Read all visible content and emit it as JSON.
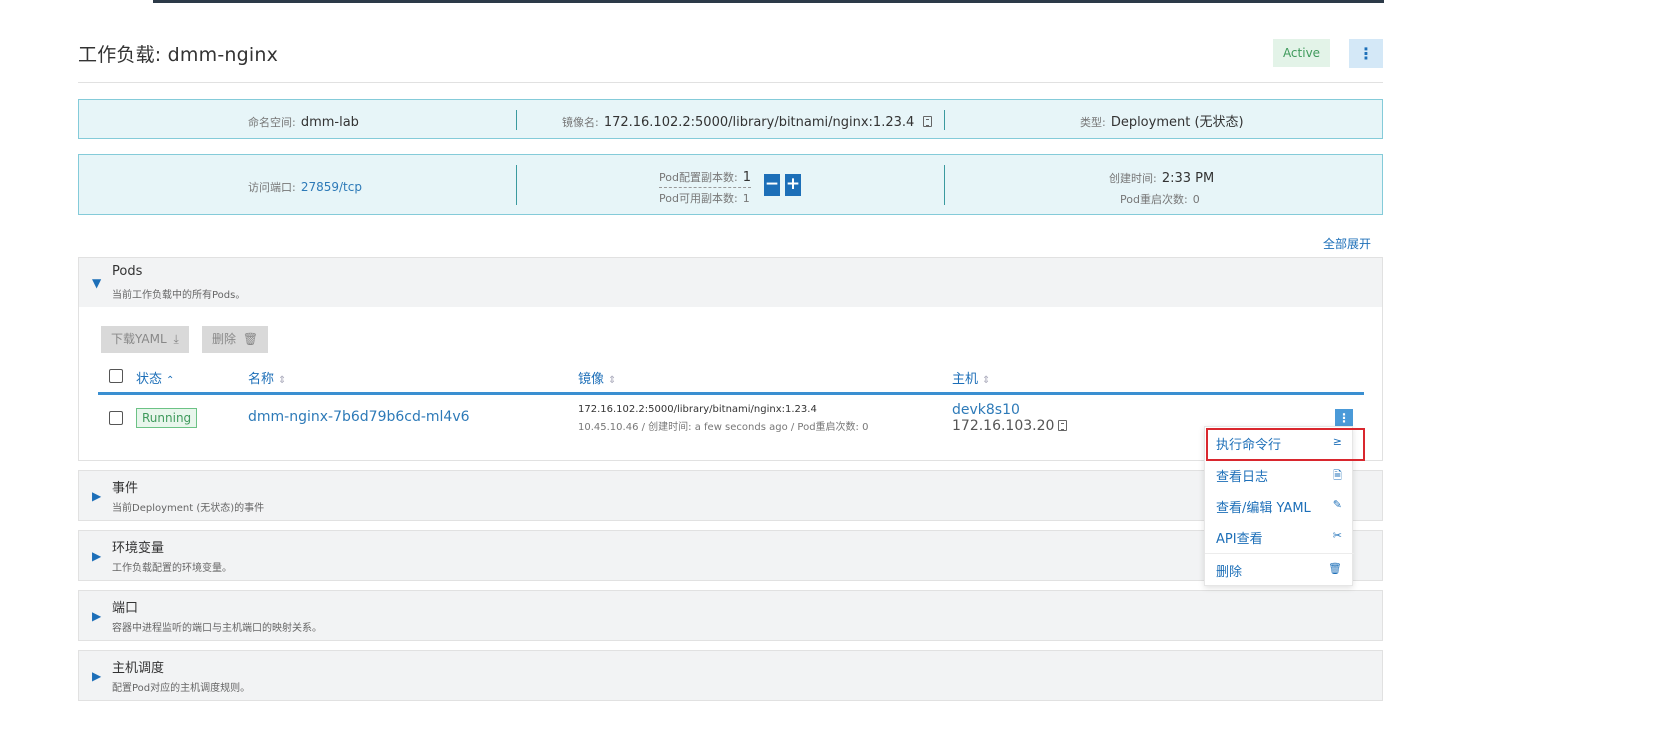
{
  "header": {
    "title": "工作负载: dmm-nginx",
    "status": "Active",
    "menu_icon": "⋮"
  },
  "info1": {
    "namespace_label": "命名空间:",
    "namespace_value": "dmm-lab",
    "image_label": "镜像名:",
    "image_value": "172.16.102.2:5000/library/bitnami/nginx:1.23.4",
    "type_label": "类型:",
    "type_value": "Deployment (无状态)"
  },
  "info2": {
    "port_label": "访问端口:",
    "port_value": "27859/tcp",
    "replicas_label": "Pod配置副本数:",
    "replicas_value": "1",
    "available_label": "Pod可用副本数:",
    "available_value": "1",
    "decrease_symbol": "−",
    "increase_symbol": "+",
    "created_label": "创建时间:",
    "created_value": "2:33 PM",
    "restarts_label": "Pod重启次数:",
    "restarts_value": "0"
  },
  "expand_all": "全部展开",
  "pods": {
    "title": "Pods",
    "subtitle": "当前工作负载中的所有Pods。",
    "download_yaml": "下载YAML",
    "delete": "删除",
    "columns": {
      "status": "状态",
      "name": "名称",
      "image": "镜像",
      "host": "主机"
    },
    "rows": [
      {
        "status": "Running",
        "name": "dmm-nginx-7b6d79b6cd-ml4v6",
        "image": "172.16.102.2:5000/library/bitnami/nginx:1.23.4",
        "meta": "10.45.10.46 / 创建时间: a few seconds ago / Pod重启次数: 0",
        "host": "devk8s10",
        "host_ip": "172.16.103.20"
      }
    ]
  },
  "row_menu": {
    "items": [
      {
        "label": "执行命令行",
        "icon": "≥"
      },
      {
        "label": "查看日志",
        "icon": "🗎"
      },
      {
        "label": "查看/编辑 YAML",
        "icon": "✎"
      },
      {
        "label": "API查看",
        "icon": "✂"
      },
      {
        "label": "删除",
        "icon": "🗑"
      }
    ]
  },
  "sections": [
    {
      "title": "事件",
      "subtitle": "当前Deployment (无状态)的事件"
    },
    {
      "title": "环境变量",
      "subtitle": "工作负载配置的环境变量。"
    },
    {
      "title": "端口",
      "subtitle": "容器中进程监听的端口与主机端口的映射关系。"
    },
    {
      "title": "主机调度",
      "subtitle": "配置Pod对应的主机调度规则。"
    }
  ],
  "colors": {
    "accent": "#1d6fb8",
    "active_green": "#3f9a5c",
    "info_bg": "#e7f5f8",
    "highlight": "#d9272e"
  }
}
